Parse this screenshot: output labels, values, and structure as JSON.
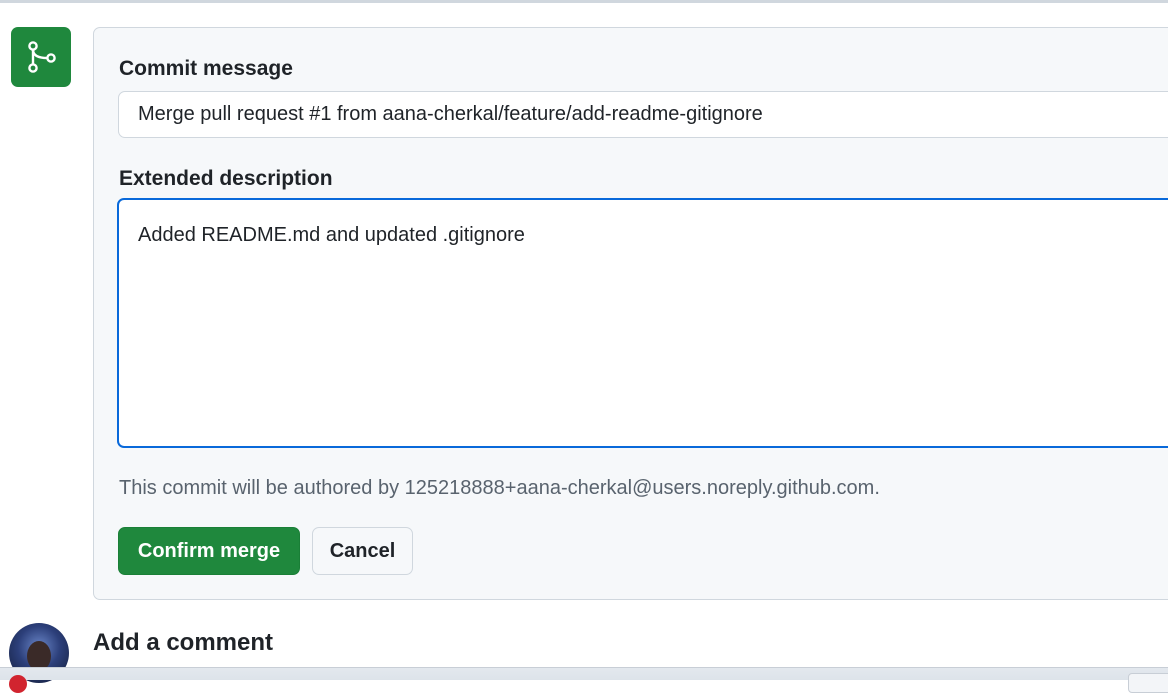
{
  "merge_form": {
    "commit_message_label": "Commit message",
    "commit_message_value": "Merge pull request #1 from aana-cherkal/feature/add-readme-gitignore",
    "extended_description_label": "Extended description",
    "extended_description_value": "Added README.md and updated .gitignore",
    "author_note": "This commit will be authored by 125218888+aana-cherkal@users.noreply.github.com.",
    "confirm_label": "Confirm merge",
    "cancel_label": "Cancel",
    "icon": "git-merge-icon",
    "accent_color": "#1f883d",
    "focus_color": "#0969da"
  },
  "comment": {
    "heading": "Add a comment",
    "avatar_icon": "avatar"
  }
}
